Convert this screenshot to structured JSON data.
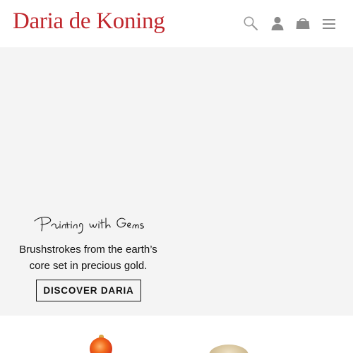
{
  "header": {
    "brand": "Daria de Koning",
    "brand_color": "#c0272d",
    "icons": [
      "search-icon",
      "account-icon",
      "shopping-bag-icon",
      "menu-icon"
    ]
  },
  "hero": {
    "script_heading": "Painting with Gems",
    "text_line_1": "Brushstrokes from the earth’s",
    "text_line_2": "core set in precious gold.",
    "cta_label": "DISCOVER DARIA"
  },
  "products": {
    "items": [
      "orange-gem-ring-image",
      "gold-pave-ring-image"
    ]
  }
}
